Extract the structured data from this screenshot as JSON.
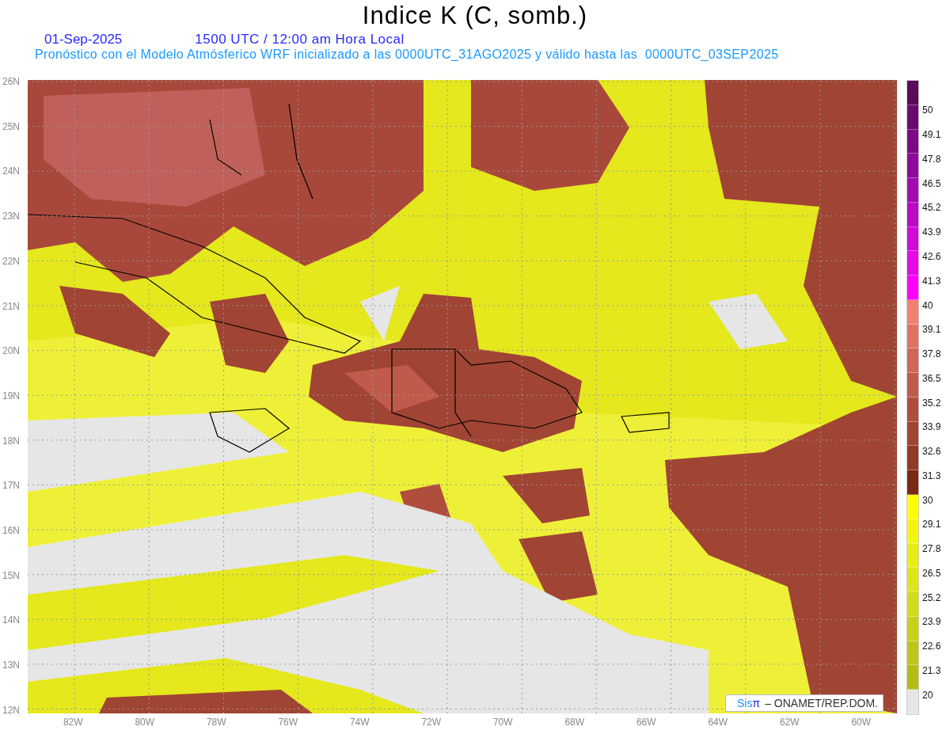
{
  "title": "Indice K (C, somb.)",
  "date": "01-Sep-2025",
  "time": "1500 UTC / 12:00 am Hora Local",
  "description": "Pronóstico con el Modelo Atmósferico WRF inicializado a las 0000UTC_31AGO2025 y válido hasta las  0000UTC_03SEP2025",
  "map": {
    "latitude_labels": [
      "26N",
      "25N",
      "24N",
      "23N",
      "22N",
      "21N",
      "20N",
      "19N",
      "18N",
      "17N",
      "16N",
      "15N",
      "14N",
      "13N",
      "12N"
    ],
    "longitude_labels": [
      "82W",
      "80W",
      "78W",
      "76W",
      "74W",
      "72W",
      "70W",
      "68W",
      "66W",
      "64W",
      "62W",
      "60W"
    ],
    "credit": {
      "logo_text": "Sis",
      "logo_symbol": "π",
      "text": "– ONAMET/REP.DOM."
    }
  },
  "color_bar": {
    "segments": [
      {
        "color": "#5a0a5a"
      },
      {
        "color": "#6a0a70"
      },
      {
        "color": "#7c0a86"
      },
      {
        "color": "#8e0a9c"
      },
      {
        "color": "#a40ab2"
      },
      {
        "color": "#ba0ac6"
      },
      {
        "color": "#d00ad8"
      },
      {
        "color": "#e40ae8"
      },
      {
        "color": "#ff00ff"
      },
      {
        "color": "#f08070"
      },
      {
        "color": "#e07262"
      },
      {
        "color": "#d06656"
      },
      {
        "color": "#c05a4a"
      },
      {
        "color": "#b04e3e"
      },
      {
        "color": "#a04434"
      },
      {
        "color": "#903a28"
      },
      {
        "color": "#7a2a14"
      },
      {
        "color": "#ffff00"
      },
      {
        "color": "#f4f414"
      },
      {
        "color": "#e8ec18"
      },
      {
        "color": "#dde41c"
      },
      {
        "color": "#d2da1c"
      },
      {
        "color": "#c8d01a"
      },
      {
        "color": "#bec618"
      },
      {
        "color": "#b4bc16"
      },
      {
        "color": "#e6e6e6"
      }
    ],
    "tick_labels": [
      "50",
      "49.1",
      "47.8",
      "46.5",
      "45.2",
      "43.9",
      "42.6",
      "41.3",
      "40",
      "39.1",
      "37.8",
      "36.5",
      "35.2",
      "33.9",
      "32.6",
      "31.3",
      "30",
      "29.1",
      "27.8",
      "26.5",
      "25.2",
      "23.9",
      "22.6",
      "21.3",
      "20"
    ]
  }
}
